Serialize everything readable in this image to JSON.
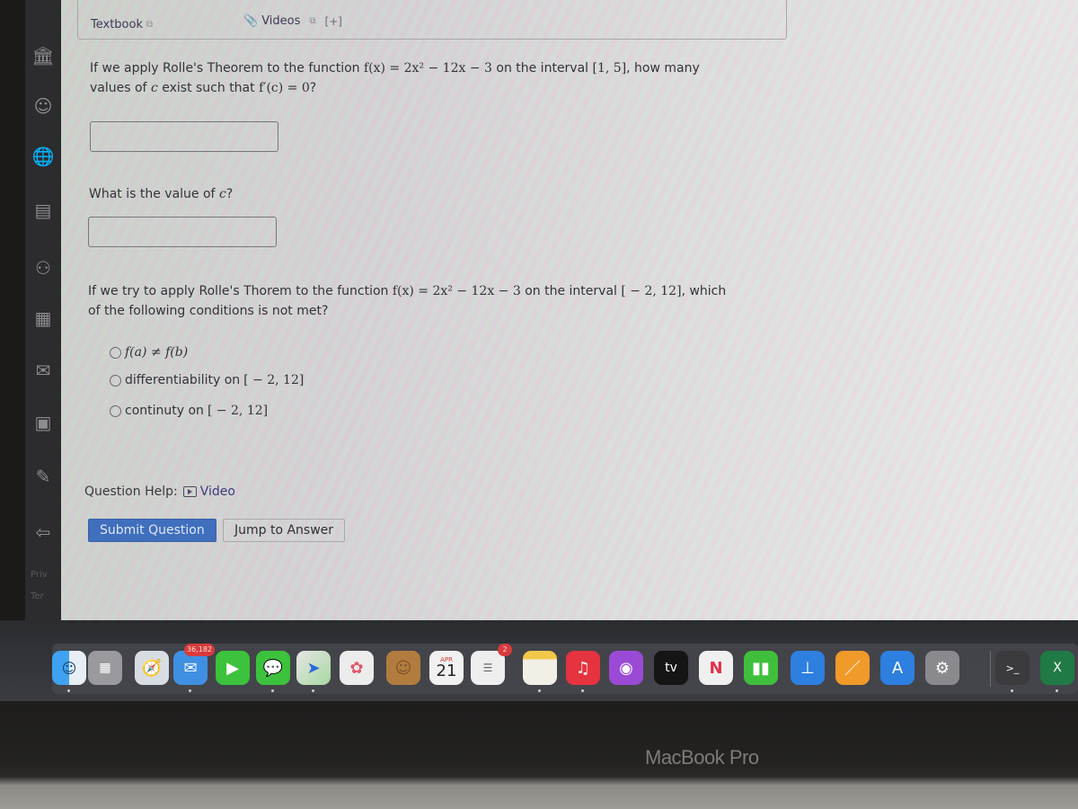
{
  "header": {
    "textbook_label": "Textbook",
    "videos_label": "Videos",
    "expand_label": "[+]"
  },
  "question1": {
    "prompt_pre": "If we apply Rolle's Theorem to the function ",
    "function": "f(x) = 2x² − 12x − 3",
    "prompt_mid": " on the interval ",
    "interval": "[1, 5]",
    "prompt_post": ", how many",
    "line2_pre": "values of ",
    "var_c": "c",
    "line2_mid": " exist such that ",
    "condition": "f′(c) = 0",
    "line2_post": "?",
    "answer_value": "",
    "answer_placeholder": ""
  },
  "question2": {
    "label_pre": "What is the value of ",
    "var_c": "c",
    "label_post": "?",
    "answer_value": "",
    "answer_placeholder": ""
  },
  "question3": {
    "prompt_pre": "If we try to apply Rolle's Thorem to the function ",
    "function": "f(x) = 2x² − 12x − 3",
    "prompt_mid": " on the interval ",
    "interval": "[ − 2, 12]",
    "prompt_post": ", which",
    "line2": "of the following conditions is not met?",
    "options": [
      {
        "text": "",
        "math": "f(a) ≠ f(b)",
        "selected": false
      },
      {
        "text": "differentiability on ",
        "math": "[ − 2, 12]",
        "selected": false
      },
      {
        "text": "continuty on ",
        "math": "[ − 2, 12]",
        "selected": false
      }
    ]
  },
  "help": {
    "label": "Question Help:",
    "video_label": "Video"
  },
  "actions": {
    "submit_label": "Submit Question",
    "jump_label": "Jump to Answer"
  },
  "sidebar": {
    "items": [
      {
        "icon": "institution-icon"
      },
      {
        "icon": "user-icon"
      },
      {
        "icon": "globe-icon"
      },
      {
        "icon": "course-icon"
      },
      {
        "icon": "groups-icon"
      },
      {
        "icon": "calendar-icon"
      },
      {
        "icon": "inbox-icon"
      },
      {
        "icon": "history-icon"
      },
      {
        "icon": "edit-icon"
      },
      {
        "icon": "logout-icon"
      }
    ],
    "footer_1": "Priv",
    "footer_2": "Ter"
  },
  "dock": {
    "mail_badge": "36,182",
    "reminders_badge": "2",
    "calendar_month": "APR",
    "calendar_day": "21",
    "tv_label": "tv",
    "apps": [
      "Finder",
      "Launchpad",
      "Safari",
      "Mail",
      "FaceTime",
      "Messages",
      "Maps",
      "Photos",
      "Contacts",
      "Calendar",
      "Reminders",
      "Notes",
      "Music",
      "Podcasts",
      "TV",
      "News",
      "Numbers",
      "Keynote",
      "Pages",
      "App Store",
      "System Settings",
      "Terminal",
      "Excel"
    ]
  },
  "device": {
    "brand": "MacBook Pro"
  }
}
